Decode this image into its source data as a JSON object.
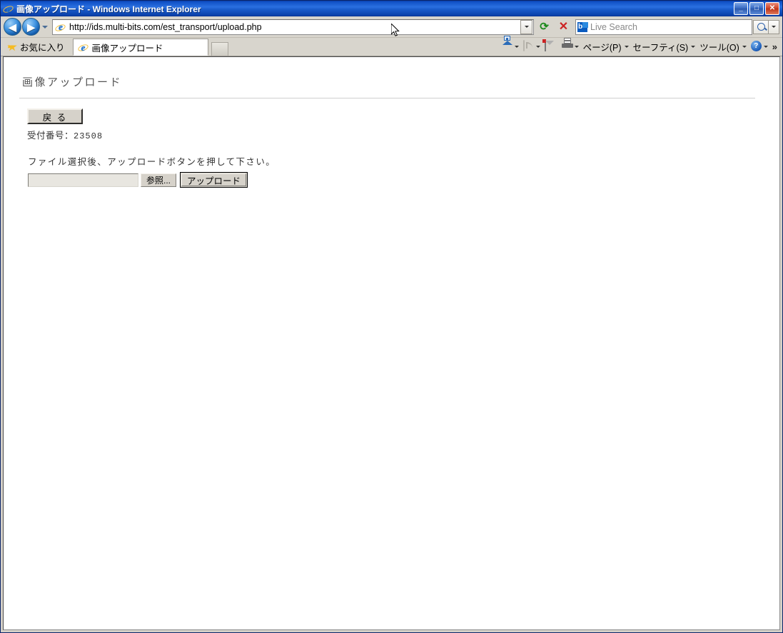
{
  "window": {
    "title": "画像アップロード - Windows Internet Explorer",
    "minimize_label": "_",
    "maximize_label": "□",
    "close_label": "✕"
  },
  "toolbar": {
    "back_label": "◀",
    "forward_label": "▶",
    "url_value": "http://ids.multi-bits.com/est_transport/upload.php",
    "url_icon": "ie-page-icon",
    "refresh_label": "⟳",
    "stop_label": "✕",
    "search_placeholder": "Live Search",
    "search_icon": "live-search-icon",
    "go_icon": "magnifier-icon"
  },
  "tabs": {
    "favorites_label": "お気に入り",
    "favorites_icon": "star-icon",
    "active_tab_label": "画像アップロード",
    "active_tab_icon": "ie-page-icon",
    "new_tab_label": ""
  },
  "command_bar": {
    "items": [
      {
        "label": "",
        "icon": "home-icon",
        "has_caret": true
      },
      {
        "label": "",
        "icon": "rss-feeds-icon",
        "has_caret": true
      },
      {
        "label": "",
        "icon": "mail-icon",
        "has_caret": false
      },
      {
        "label": "",
        "icon": "print-icon",
        "has_caret": true
      },
      {
        "label": "ページ(P)",
        "icon": "",
        "has_caret": true
      },
      {
        "label": "セーフティ(S)",
        "icon": "",
        "has_caret": true
      },
      {
        "label": "ツール(O)",
        "icon": "",
        "has_caret": true
      },
      {
        "label": "",
        "icon": "help-icon",
        "has_caret": true
      }
    ],
    "overflow_label": "»"
  },
  "page": {
    "heading": "画像アップロード",
    "back_button": "戻 る",
    "receipt_label": "受付番号：",
    "receipt_number": "23508",
    "instruction": "ファイル選択後、アップロードボタンを押して下さい。",
    "file_input_value": "",
    "browse_button": "参照...",
    "upload_button": "アップロード"
  }
}
